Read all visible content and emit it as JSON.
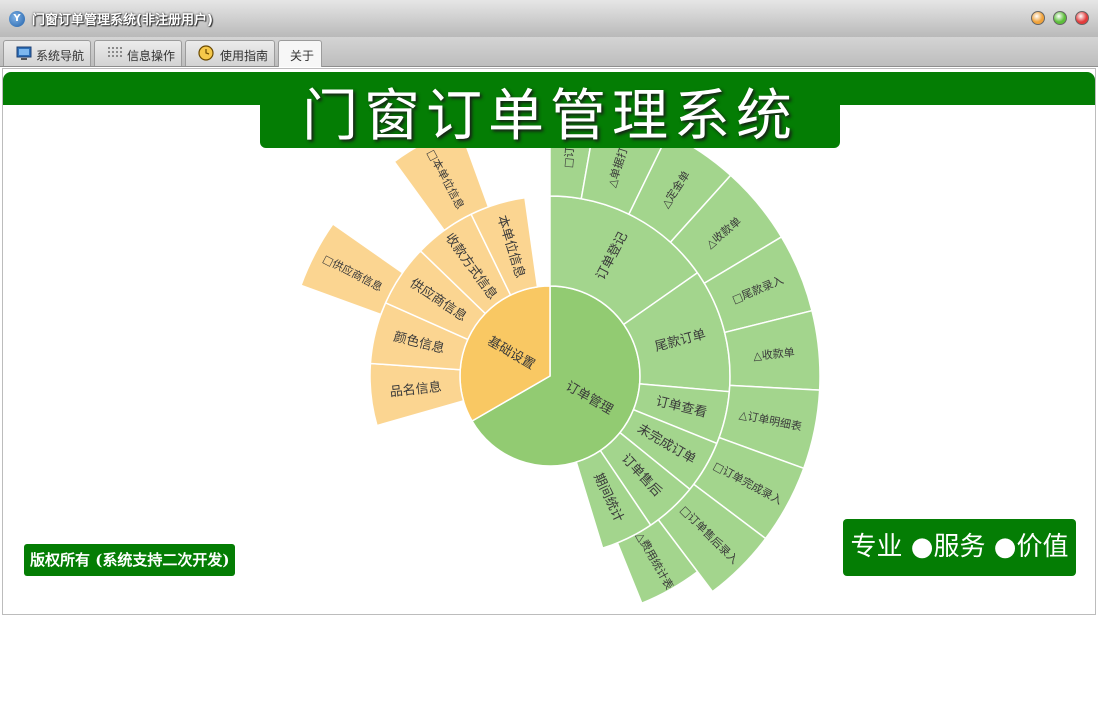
{
  "window": {
    "title": "门窗订单管理系统(非注册用户)",
    "app_icon": "Y",
    "buttons": [
      "minimize-button",
      "maximize-button",
      "close-button"
    ],
    "button_colors": [
      "#f0a23a",
      "#5cbf3a",
      "#e23b3b"
    ]
  },
  "tabs": [
    {
      "label": "系统导航",
      "icon": "monitor-icon"
    },
    {
      "label": "信息操作",
      "icon": "grid-icon"
    },
    {
      "label": "使用指南",
      "icon": "clock-icon"
    },
    {
      "label": "关于",
      "active": true
    }
  ],
  "banner": {
    "title": "门窗订单管理系统",
    "color": "#047d04"
  },
  "sunburst": {
    "colors": {
      "green": "#a3d58d",
      "green_center": "#92cb72",
      "orange": "#fbd591",
      "orange_center": "#f9c863"
    },
    "center": [
      {
        "label": "订单管理",
        "group": "green"
      },
      {
        "label": "基础设置",
        "group": "orange"
      }
    ],
    "ring1": [
      {
        "label": "订单登记",
        "group": "green"
      },
      {
        "label": "尾款订单",
        "group": "green"
      },
      {
        "label": "订单查看",
        "group": "green"
      },
      {
        "label": "未完成订单",
        "group": "green"
      },
      {
        "label": "订单售后",
        "group": "green"
      },
      {
        "label": "期间统计",
        "group": "green"
      },
      {
        "label": "品名信息",
        "group": "orange"
      },
      {
        "label": "颜色信息",
        "group": "orange"
      },
      {
        "label": "供应商信息",
        "group": "orange"
      },
      {
        "label": "收款方式信息",
        "group": "orange"
      },
      {
        "label": "本单位信息",
        "group": "orange"
      }
    ],
    "ring2": [
      {
        "label": "□订单",
        "group": "green"
      },
      {
        "label": "△单据打印",
        "group": "green"
      },
      {
        "label": "△定金单",
        "group": "green"
      },
      {
        "label": "△收款单",
        "group": "green"
      },
      {
        "label": "□尾款录入",
        "group": "green"
      },
      {
        "label": "△收款单",
        "group": "green"
      },
      {
        "label": "△订单明细表",
        "group": "green"
      },
      {
        "label": "□订单完成录入",
        "group": "green"
      },
      {
        "label": "□订单售后录入",
        "group": "green"
      },
      {
        "label": "△费用统计表",
        "group": "green"
      },
      {
        "label": "□供应商信息",
        "group": "orange"
      },
      {
        "label": "□本单位信息",
        "group": "orange"
      }
    ]
  },
  "footer": {
    "copyright": "版权所有 (系统支持二次开发)",
    "slogan": "专业 ●服务 ●价值"
  }
}
